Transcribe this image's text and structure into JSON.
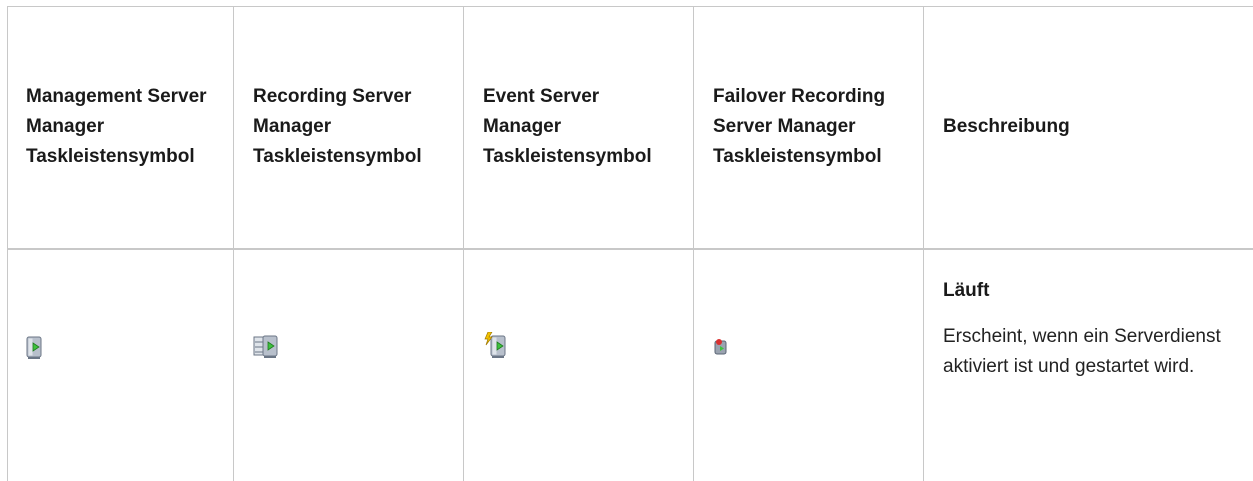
{
  "table": {
    "headers": [
      "Management Server Manager Taskleistensymbol",
      "Recording Server Manager Taskleistensymbol",
      "Event Server Manager Taskleistensymbol",
      "Failover Recording Server Manager Taskleistensymbol",
      "Beschreibung"
    ],
    "rows": [
      {
        "icons": [
          "management-server-running-icon",
          "recording-server-running-icon",
          "event-server-running-icon",
          "failover-server-running-icon"
        ],
        "status_title": "Läuft",
        "status_description": "Erscheint, wenn ein Serverdienst aktiviert ist und gestartet wird."
      }
    ]
  },
  "colors": {
    "grid": "#c8c8c8",
    "play_green": "#3ec23e",
    "server_grey": "#9aa3b0"
  }
}
